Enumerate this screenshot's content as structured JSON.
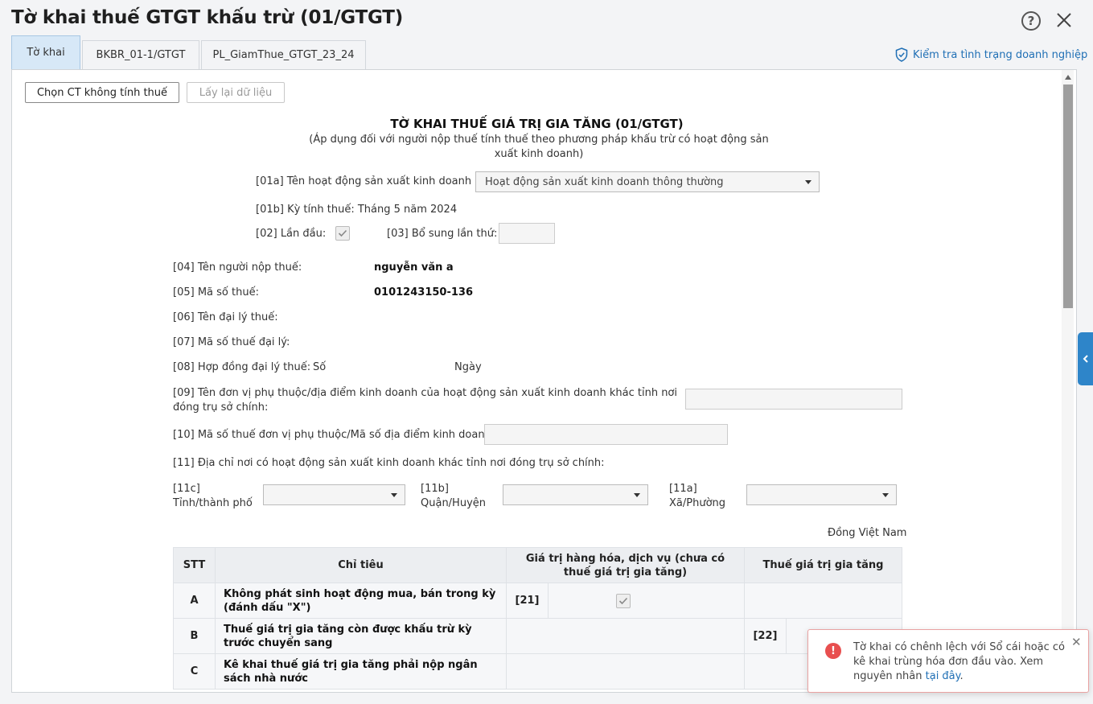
{
  "header": {
    "title": "Tờ khai thuế GTGT khấu trừ (01/GTGT)",
    "help_symbol": "?"
  },
  "tabs": [
    {
      "label": "Tờ khai",
      "active": true
    },
    {
      "label": "BKBR_01-1/GTGT",
      "active": false
    },
    {
      "label": "PL_GiamThue_GTGT_23_24",
      "active": false
    }
  ],
  "check_status_link": "Kiểm tra tình trạng doanh nghiệp",
  "toolbar": {
    "choose_button": "Chọn CT không tính thuế",
    "reload_button": "Lấy lại dữ liệu"
  },
  "form": {
    "title": "TỜ KHAI THUẾ GIÁ TRỊ GIA TĂNG (01/GTGT)",
    "subtitle": "(Áp dụng đối với người nộp thuế tính thuế theo phương pháp khấu trừ có hoạt động sản xuất kinh doanh)",
    "activity_label": "[01a] Tên hoạt động sản xuất kinh doanh",
    "activity_value": "Hoạt động sản xuất kinh doanh thông thường",
    "period": "[01b] Kỳ tính thuế: Tháng 5 năm 2024",
    "first_time_label": "[02] Lần đầu:",
    "first_time_checked": true,
    "supplement_label": "[03] Bổ sung lần thứ:",
    "taxpayer_name_label": "[04] Tên người nộp thuế:",
    "taxpayer_name_value": "nguyễn văn a",
    "tax_code_label": "[05] Mã số thuế:",
    "tax_code_value": "0101243150-136",
    "agent_name_label": "[06] Tên đại lý thuế:",
    "agent_code_label": "[07] Mã số thuế đại lý:",
    "agent_contract_label": "[08] Hợp đồng đại lý thuế:",
    "agent_contract_no": "Số",
    "agent_contract_date": "Ngày",
    "dependent_unit_label": "[09] Tên đơn vị phụ thuộc/địa điểm kinh doanh của hoạt động sản xuất kinh doanh khác tỉnh nơi đóng trụ sở chính:",
    "dependent_code_label": "[10] Mã số thuế đơn vị phụ thuộc/Mã số địa điểm kinh doanh:",
    "address_label": "[11] Địa chỉ nơi có hoạt động sản xuất kinh doanh khác tỉnh nơi đóng trụ sở chính:",
    "province_label": "[11c] Tỉnh/thành phố",
    "district_label": "[11b] Quận/Huyện",
    "ward_label": "[11a] Xã/Phường",
    "currency_note": "Đồng Việt Nam"
  },
  "table": {
    "headers": [
      "STT",
      "Chỉ tiêu",
      "Giá trị hàng hóa, dịch vụ (chưa có thuế giá trị gia tăng)",
      "Thuế giá trị gia tăng"
    ],
    "rows": [
      {
        "stt": "A",
        "label": "Không phát sinh hoạt động mua, bán trong kỳ (đánh dấu \"X\")",
        "code": "[21]"
      },
      {
        "stt": "B",
        "label": "Thuế giá trị gia tăng còn được khấu trừ kỳ trước chuyển sang",
        "code": "[22]"
      },
      {
        "stt": "C",
        "label": "Kê khai thuế giá trị gia tăng phải nộp ngân sách nhà nước"
      }
    ]
  },
  "toast": {
    "message": "Tờ khai có chênh lệch với Sổ cái hoặc có kê khai trùng hóa đơn đầu vào. Xem nguyên nhân ",
    "link": "tại đây",
    "suffix": "."
  },
  "colors": {
    "accent": "#2e85c9",
    "link": "#1f6fb5",
    "error": "#e84f4f",
    "active_tab": "#d7e8f7"
  }
}
